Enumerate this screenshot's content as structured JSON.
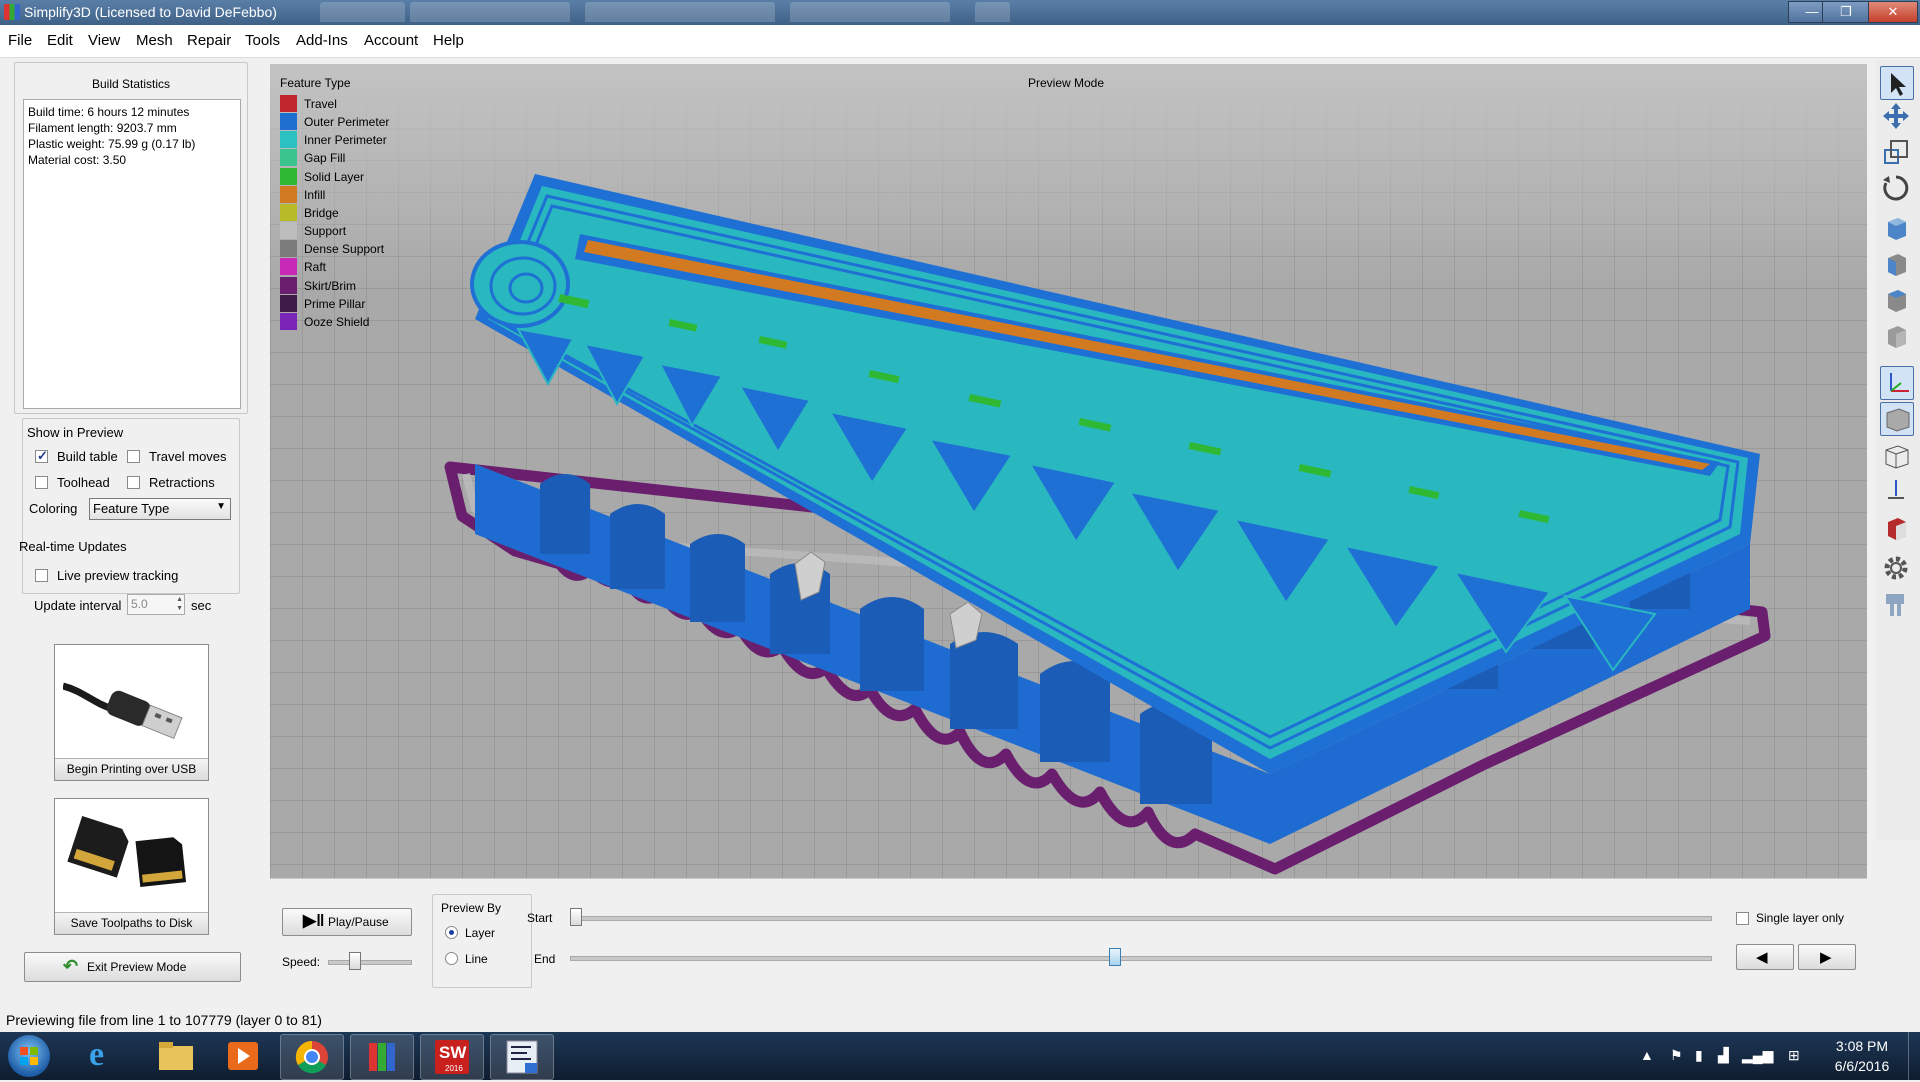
{
  "window": {
    "title": "Simplify3D (Licensed to David DeFebbo)",
    "minimize_glyph": "—",
    "maximize_glyph": "❐",
    "close_glyph": "✕"
  },
  "menu": [
    "File",
    "Edit",
    "View",
    "Mesh",
    "Repair",
    "Tools",
    "Add-Ins",
    "Account",
    "Help"
  ],
  "build_statistics": {
    "heading": "Build Statistics",
    "lines": [
      "Build time: 6 hours 12 minutes",
      "Filament length: 9203.7 mm",
      "Plastic weight: 75.99 g (0.17 lb)",
      "Material cost: 3.50"
    ]
  },
  "show_in_preview": {
    "heading": "Show in Preview",
    "build_table": {
      "label": "Build table",
      "checked": true
    },
    "travel_moves": {
      "label": "Travel moves",
      "checked": false
    },
    "toolhead": {
      "label": "Toolhead",
      "checked": false
    },
    "retractions": {
      "label": "Retractions",
      "checked": false
    },
    "coloring_label": "Coloring",
    "coloring_value": "Feature Type"
  },
  "realtime_updates": {
    "heading": "Real-time Updates",
    "live_preview": {
      "label": "Live preview tracking",
      "checked": false
    },
    "update_interval_label": "Update interval",
    "update_interval_value": "5.0",
    "update_interval_unit": "sec"
  },
  "actions": {
    "usb_label": "Begin Printing over USB",
    "sd_label": "Save Toolpaths to Disk",
    "exit_label": "Exit Preview Mode"
  },
  "viewport": {
    "legend_title": "Feature Type",
    "mode_label": "Preview Mode",
    "legend": [
      {
        "name": "Travel",
        "color": "#c0262b"
      },
      {
        "name": "Outer Perimeter",
        "color": "#1f6fd1"
      },
      {
        "name": "Inner Perimeter",
        "color": "#2bc0c2"
      },
      {
        "name": "Gap Fill",
        "color": "#3cc48f"
      },
      {
        "name": "Solid Layer",
        "color": "#2eb833"
      },
      {
        "name": "Infill",
        "color": "#d27a22"
      },
      {
        "name": "Bridge",
        "color": "#b7bb2a"
      },
      {
        "name": "Support",
        "color": "#bdbdbd"
      },
      {
        "name": "Dense Support",
        "color": "#7c7c7c"
      },
      {
        "name": "Raft",
        "color": "#c728b6"
      },
      {
        "name": "Skirt/Brim",
        "color": "#6a1f6e"
      },
      {
        "name": "Prime Pillar",
        "color": "#3d1b47"
      },
      {
        "name": "Ooze Shield",
        "color": "#7a24b8"
      }
    ]
  },
  "toolbar_icons": [
    "select-icon",
    "move-icon",
    "scale-icon",
    "rotate-icon",
    "view-default-icon",
    "view-front-icon",
    "view-top-icon",
    "view-side-icon",
    "axes-icon",
    "build-volume-icon",
    "wireframe-icon",
    "origin-icon",
    "section-icon",
    "settings-icon",
    "toolhead-icon"
  ],
  "playback": {
    "play_label": "Play/Pause",
    "speed_label": "Speed:",
    "speed_fraction": 0.29,
    "preview_by_heading": "Preview By",
    "layer_label": "Layer",
    "line_label": "Line",
    "selected": "Layer",
    "start_label": "Start",
    "end_label": "End",
    "start_fraction": 0.0,
    "end_fraction": 0.477,
    "single_layer": {
      "label": "Single layer only",
      "checked": false
    },
    "prev_glyph": "◀",
    "next_glyph": "▶"
  },
  "status": {
    "text": "Previewing file from line 1 to 107779 (layer 0 to 81)"
  },
  "taskbar": {
    "time": "3:08 PM",
    "date": "6/6/2016",
    "apps": [
      "start-orb",
      "internet-explorer",
      "file-explorer",
      "media-player",
      "chrome",
      "simplify3d",
      "solidworks-2016",
      "edrawings"
    ],
    "sw_label": "SW",
    "sw_year": "2016"
  }
}
